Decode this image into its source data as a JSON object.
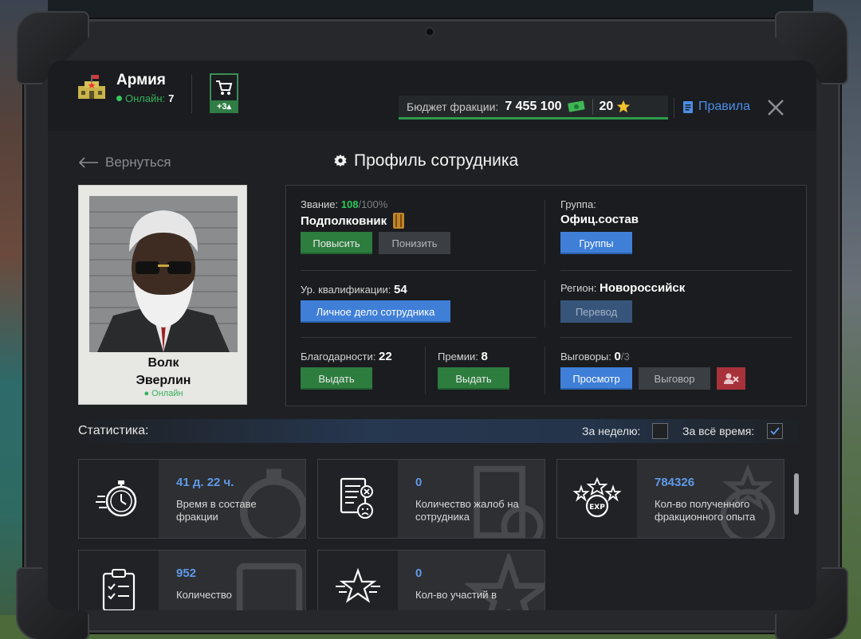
{
  "header": {
    "faction_name": "Армия",
    "online_label": "Онлайн:",
    "online_count": "7",
    "cart_badge": "+3",
    "budget_label": "Бюджет фракции:",
    "budget_value": "7 455 100",
    "stars_value": "20",
    "rules_label": "Правила"
  },
  "nav": {
    "back_label": "Вернуться",
    "page_title": "Профиль сотрудника"
  },
  "employee": {
    "first_name": "Волк",
    "last_name": "Эверлин",
    "status": "Онлайн"
  },
  "profile": {
    "rank_label": "Звание:",
    "rank_progress": "108",
    "rank_progress_max": "/100%",
    "rank_name": "Подполковник",
    "promote_button": "Повысить",
    "demote_button": "Понизить",
    "group_label": "Группа:",
    "group_value": "Офиц.состав",
    "groups_button": "Группы",
    "qualification_label": "Ур. квалификации:",
    "qualification_value": "54",
    "personal_file_button": "Личное дело сотрудника",
    "region_label": "Регион:",
    "region_value": "Новороссийск",
    "transfer_button": "Перевод",
    "thanks_label": "Благодарности:",
    "thanks_value": "22",
    "thanks_button": "Выдать",
    "bonus_label": "Премии:",
    "bonus_value": "8",
    "bonus_button": "Выдать",
    "reprimand_label": "Выговоры:",
    "reprimand_value": "0",
    "reprimand_max": "/3",
    "view_button": "Просмотр",
    "reprimand_button": "Выговор"
  },
  "statistics": {
    "title": "Статистика:",
    "week_label": "За неделю:",
    "week_checked": false,
    "all_time_label": "За всё время:",
    "all_time_checked": true,
    "cards": [
      {
        "icon": "stopwatch-icon",
        "value": "41 д. 22 ч.",
        "text": "Время в составе фракции"
      },
      {
        "icon": "complaint-document-icon",
        "value": "0",
        "text": "Количество жалоб на сотрудника"
      },
      {
        "icon": "exp-stars-icon",
        "value": "784326",
        "text": "Кол-во полученного фракционного опыта"
      },
      {
        "icon": "clipboard-checklist-icon",
        "value": "952",
        "text": "Количество"
      },
      {
        "icon": "winged-star-icon",
        "value": "0",
        "text": "Кол-во участий в"
      }
    ]
  },
  "colors": {
    "accent_blue": "#3f7fd8",
    "accent_green": "#2d7d3f",
    "stat_value_blue": "#5f9ae8",
    "online_green": "#35b15a"
  }
}
